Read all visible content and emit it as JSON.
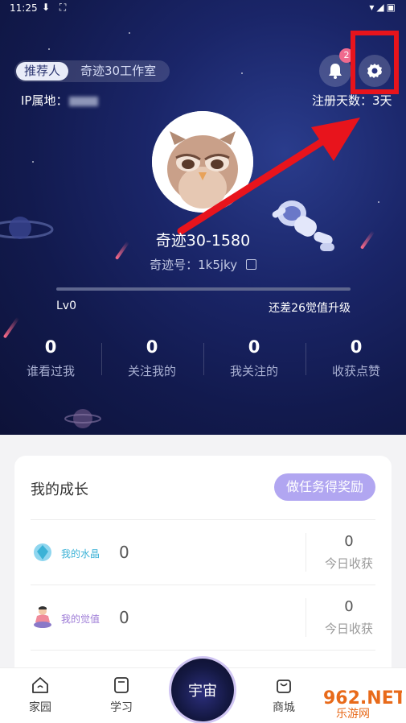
{
  "statusbar": {
    "time": "11:25",
    "left_icons": "⬇ ⛶",
    "right_icons": "▾◢▣"
  },
  "header": {
    "referrer_tag": "推荐人",
    "referrer_name": "奇迹30工作室",
    "ip_label": "IP属地：",
    "notification_count": "2",
    "register_days": "注册天数：3天"
  },
  "profile": {
    "username": "奇迹30-1580",
    "uid": "奇迹号：1k5jky",
    "copy_icon": "copy-icon",
    "level": "Lv0",
    "level_need": "还差26觉值升级",
    "progress": 0
  },
  "stats": [
    {
      "num": "0",
      "label": "谁看过我"
    },
    {
      "num": "0",
      "label": "关注我的"
    },
    {
      "num": "0",
      "label": "我关注的"
    },
    {
      "num": "0",
      "label": "收获点赞"
    }
  ],
  "growth": {
    "title": "我的成长",
    "task_button": "做任务得奖励",
    "rows": [
      {
        "label": "我的水晶",
        "value": "0",
        "today_value": "0",
        "today_label": "今日收获",
        "label_color": "#3bb2d6",
        "icon": "crystal-icon"
      },
      {
        "label": "我的觉值",
        "value": "0",
        "today_value": "0",
        "today_label": "今日收获",
        "label_color": "#9c7ad6",
        "icon": "meditation-icon"
      }
    ]
  },
  "nav": {
    "home": "家园",
    "study": "学习",
    "center": "宇宙",
    "shop": "商城"
  },
  "watermark": {
    "text": "962.NET",
    "sub": "乐游网"
  },
  "colors": {
    "accent": "#b1a6f1",
    "highlight": "#e8141c",
    "badge": "#f06a8e"
  }
}
